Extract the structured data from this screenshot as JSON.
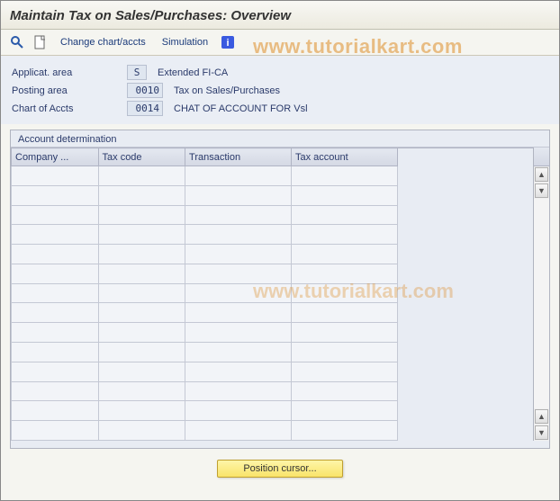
{
  "title": "Maintain Tax on Sales/Purchases: Overview",
  "watermark": "www.tutorialkart.com",
  "toolbar": {
    "change_chart_label": "Change chart/accts",
    "simulation_label": "Simulation"
  },
  "form": {
    "applicat_area": {
      "label": "Applicat. area",
      "value": "S",
      "desc": "Extended FI-CA"
    },
    "posting_area": {
      "label": "Posting area",
      "value": "0010",
      "desc": "Tax on Sales/Purchases"
    },
    "chart_of_accts": {
      "label": "Chart of Accts",
      "value": "0014",
      "desc": "CHAT OF ACCOUNT FOR Vsl"
    }
  },
  "panel": {
    "title": "Account determination"
  },
  "table": {
    "columns": [
      "Company ...",
      "Tax code",
      "Transaction",
      "Tax account"
    ],
    "row_count": 14
  },
  "footer": {
    "position_cursor": "Position cursor..."
  }
}
